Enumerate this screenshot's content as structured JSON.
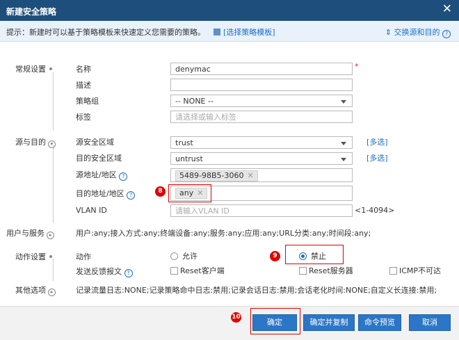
{
  "window": {
    "title": "新建安全策略",
    "close": "✕"
  },
  "tip": {
    "text": "提示：新建时可以基于策略模板来快速定义您需要的策略。",
    "template_link": "[选择策略模板]",
    "swap_link": "交换源和目的"
  },
  "sections": {
    "general": "常规设置",
    "src_dst": "源与目的",
    "user_service": "用户与服务",
    "action": "动作设置",
    "other": "其他选项"
  },
  "general": {
    "name_label": "名称",
    "name_value": "denymac",
    "required_mark": "*",
    "desc_label": "描述",
    "desc_value": "",
    "group_label": "策略组",
    "group_value": "-- NONE --",
    "tag_label": "标签",
    "tag_placeholder": "请选择或输入标签"
  },
  "src_dst": {
    "src_zone_label": "源安全区域",
    "src_zone_value": "trust",
    "multi_select": "[多选]",
    "dst_zone_label": "目的安全区域",
    "dst_zone_value": "untrust",
    "src_addr_label": "源地址/地区",
    "src_addr_tag": "5489-98B5-3060",
    "dst_addr_label": "目的地址/地区",
    "dst_addr_tag": "any",
    "vlan_label": "VLAN ID",
    "vlan_placeholder": "请输入VLAN ID",
    "vlan_range": "<1-4094>"
  },
  "user_service": {
    "summary": "用户:any;接入方式:any;终端设备:any;服务:any;应用:any;URL分类:any;时间段:any;"
  },
  "action": {
    "action_label": "动作",
    "permit": "允许",
    "deny": "禁止",
    "feedback_label": "发送反馈报文",
    "reset_client": "Reset客户端",
    "reset_server": "Reset服务器",
    "icmp_unreachable": "ICMP不可达"
  },
  "other": {
    "summary": "记录流量日志:NONE;记录策略命中日志:禁用;记录会话日志:禁用;会话老化时间:NONE;自定义长连接:禁用;"
  },
  "buttons": {
    "ok": "确定",
    "ok_copy": "确定并复制",
    "cmd_preview": "命令预览",
    "cancel": "取消"
  },
  "badges": {
    "b8": "8",
    "b9": "9",
    "b10": "10"
  },
  "colors": {
    "title_bg": "#1e4f7c",
    "accent": "#2b76c7",
    "highlight": "#e00000"
  }
}
